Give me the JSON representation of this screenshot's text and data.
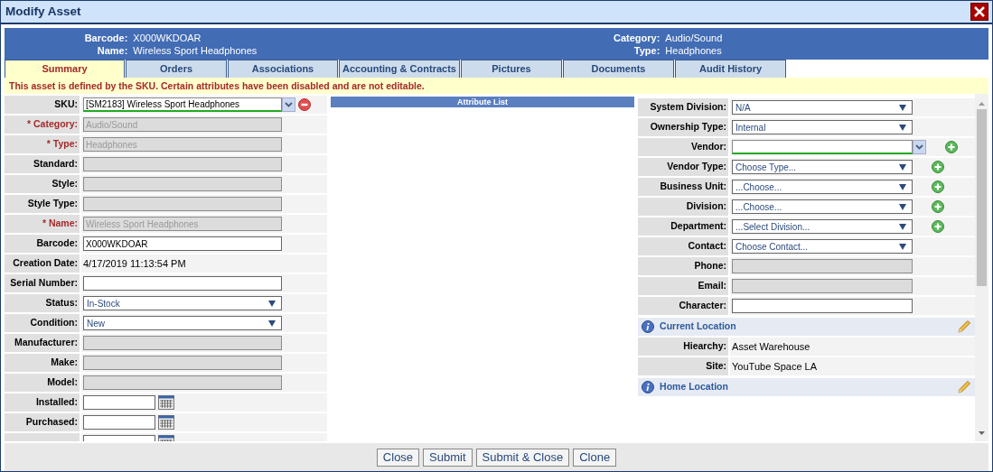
{
  "window": {
    "title": "Modify Asset"
  },
  "header": {
    "left": [
      {
        "label": "Barcode:",
        "value": "X000WKDOAR"
      },
      {
        "label": "Name:",
        "value": "Wireless Sport Headphones"
      }
    ],
    "right": [
      {
        "label": "Category:",
        "value": "Audio/Sound"
      },
      {
        "label": "Type:",
        "value": "Headphones"
      }
    ]
  },
  "tabs": [
    {
      "label": "Summary",
      "selected": true
    },
    {
      "label": "Orders",
      "selected": false
    },
    {
      "label": "Associations",
      "selected": false
    },
    {
      "label": "Accounting & Contracts",
      "selected": false
    },
    {
      "label": "Pictures",
      "selected": false
    },
    {
      "label": "Documents",
      "selected": false
    },
    {
      "label": "Audit History",
      "selected": false
    }
  ],
  "notice": "This asset is defined by the SKU. Certain attributes have been disabled and are not editable.",
  "left_fields": [
    {
      "label": "SKU:",
      "required": false,
      "kind": "combo",
      "value": "[SM2183] Wireless Sport Headphones",
      "removable": true
    },
    {
      "label": "* Category:",
      "required": true,
      "kind": "text",
      "disabled": true,
      "value": "Audio/Sound"
    },
    {
      "label": "* Type:",
      "required": true,
      "kind": "text",
      "disabled": true,
      "value": "Headphones"
    },
    {
      "label": "Standard:",
      "required": false,
      "kind": "text",
      "disabled": true
    },
    {
      "label": "Style:",
      "required": false,
      "kind": "text",
      "disabled": true
    },
    {
      "label": "Style Type:",
      "required": false,
      "kind": "text",
      "disabled": true
    },
    {
      "label": "* Name:",
      "required": true,
      "kind": "text",
      "disabled": true,
      "value": "Wireless Sport Headphones"
    },
    {
      "label": "Barcode:",
      "required": false,
      "kind": "text",
      "disabled": false,
      "value": "X000WKDOAR"
    },
    {
      "label": "Creation Date:",
      "required": false,
      "kind": "static",
      "value": "4/17/2019 11:13:54 PM"
    },
    {
      "label": "Serial Number:",
      "required": false,
      "kind": "text",
      "disabled": false
    },
    {
      "label": "Status:",
      "required": false,
      "kind": "select",
      "value": "In-Stock"
    },
    {
      "label": "Condition:",
      "required": false,
      "kind": "select",
      "value": "New"
    },
    {
      "label": "Manufacturer:",
      "required": false,
      "kind": "text",
      "disabled": true
    },
    {
      "label": "Make:",
      "required": false,
      "kind": "text",
      "disabled": true
    },
    {
      "label": "Model:",
      "required": false,
      "kind": "text",
      "disabled": true
    },
    {
      "label": "Installed:",
      "required": false,
      "kind": "date"
    },
    {
      "label": "Purchased:",
      "required": false,
      "kind": "date"
    },
    {
      "kind": "date"
    }
  ],
  "attribute_list": {
    "title": "Attribute List"
  },
  "right_fields": [
    {
      "label": "System Division:",
      "kind": "select",
      "value": "N/A",
      "addable": false
    },
    {
      "label": "Ownership Type:",
      "kind": "select",
      "value": "Internal",
      "addable": false
    },
    {
      "label": "Vendor:",
      "kind": "combo",
      "addable": true
    },
    {
      "label": "Vendor Type:",
      "kind": "select",
      "value": "Choose Type...",
      "addable": true
    },
    {
      "label": "Business Unit:",
      "kind": "select",
      "value": "...Choose...",
      "addable": true
    },
    {
      "label": "Division:",
      "kind": "select",
      "value": "...Choose...",
      "addable": true
    },
    {
      "label": "Department:",
      "kind": "select",
      "value": "...Select Division...",
      "addable": true
    },
    {
      "label": "Contact:",
      "kind": "select",
      "value": "Choose Contact...",
      "addable": false
    },
    {
      "label": "Phone:",
      "kind": "text",
      "disabled": true,
      "addable": false
    },
    {
      "label": "Email:",
      "kind": "text",
      "disabled": true,
      "addable": false
    },
    {
      "label": "Character:",
      "kind": "text",
      "disabled": false,
      "addable": false
    },
    {
      "kind": "section",
      "title": "Current Location"
    },
    {
      "label": "Hiearchy:",
      "kind": "static",
      "value": "Asset Warehouse",
      "addable": false
    },
    {
      "label": "Site:",
      "kind": "static",
      "value": "YouTube Space LA",
      "addable": false
    },
    {
      "kind": "section",
      "title": "Home Location"
    }
  ],
  "buttons": [
    "Close",
    "Submit",
    "Submit & Close",
    "Clone"
  ]
}
